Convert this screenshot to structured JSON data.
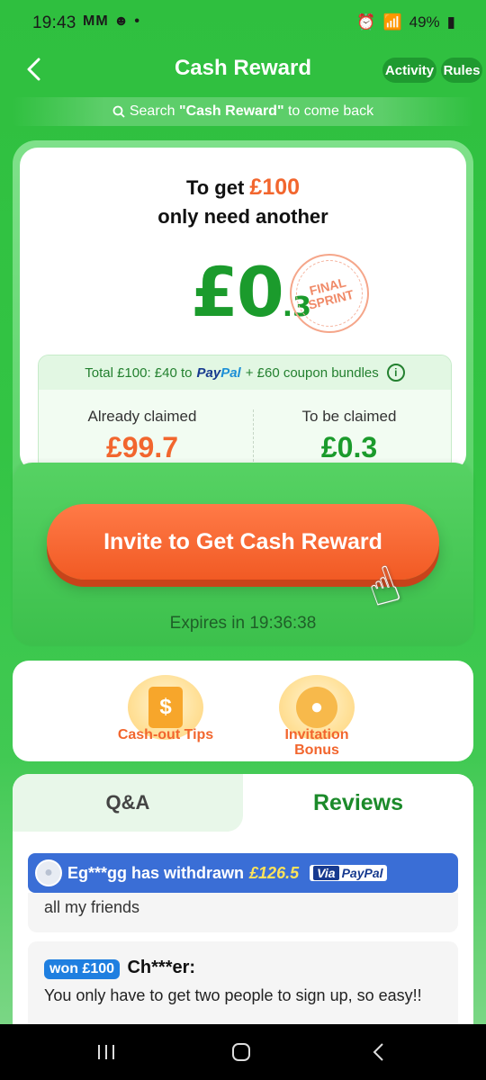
{
  "status_bar": {
    "time": "19:43",
    "left_icons": "MM ☻ •",
    "battery": "49%",
    "icons": [
      "alarm-icon",
      "wifi-icon",
      "call-icon",
      "signal-icon",
      "battery-icon"
    ]
  },
  "header": {
    "title": "Cash Reward",
    "activity_label": "Activity",
    "rules_label": "Rules"
  },
  "search_banner": {
    "prefix": "Search ",
    "keyword": "\"Cash Reward\"",
    "suffix": " to come back"
  },
  "reward": {
    "line1_prefix": "To get ",
    "target_amount": "£100",
    "line2": "only need another",
    "remaining_main": "£0",
    "remaining_decimal": ".3",
    "stamp_line1": "FINAL",
    "stamp_line2": "SPRINT",
    "total_prefix": "Total £100: £40 to ",
    "paypal_a": "Pay",
    "paypal_b": "Pal",
    "total_suffix": " + £60 coupon bundles",
    "info_icon": "i",
    "claimed_label": "Already claimed",
    "claimed_value": "£99.7",
    "to_claim_label": "To be claimed",
    "to_claim_value": "£0.3",
    "invite_label": "Invite to Get Cash Reward",
    "expires": "Expires in 19:36:38"
  },
  "tips": {
    "cash_label_1": "Cash-out Tips",
    "bonus_label_1": "Invitation",
    "bonus_label_2": "Bonus"
  },
  "tabs": {
    "qa_label": "Q&A",
    "reviews_label": "Reviews"
  },
  "withdraw": {
    "user": "Eg***gg has withdrawn ",
    "amount": "£126.5",
    "via": "Via",
    "paypal": "PayPal"
  },
  "reviews": {
    "review1_text": "all my friends",
    "review2_badge": "won £100",
    "review2_user": "Ch***er:",
    "review2_text": "You only have to get two people to sign up, so easy!!"
  },
  "colors": {
    "brand_green": "#2fbf3f",
    "accent_orange": "#f2662e",
    "money_green": "#1b9b2c"
  }
}
